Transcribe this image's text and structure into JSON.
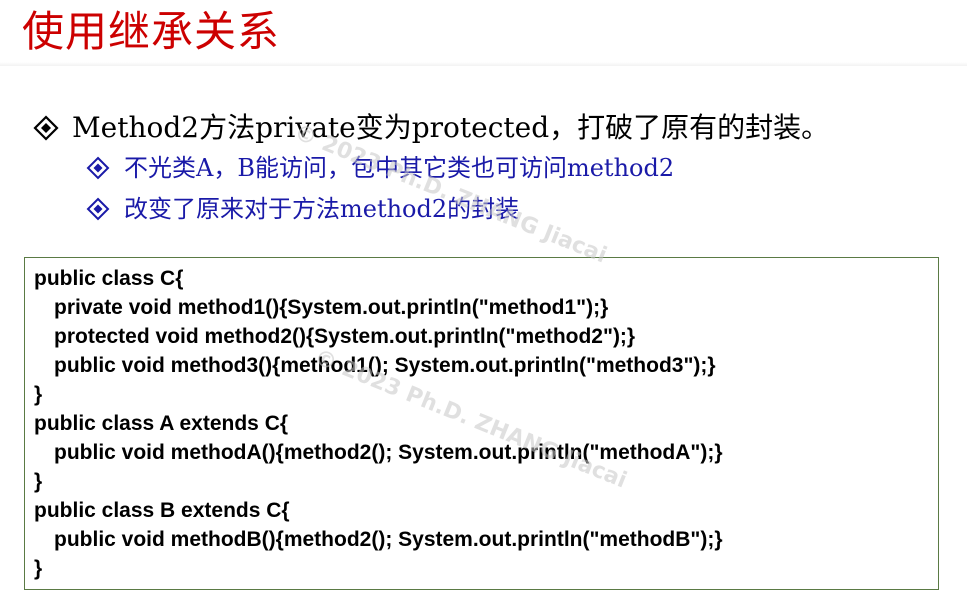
{
  "slide": {
    "title": "使用继承关系",
    "bullets": [
      {
        "level": 1,
        "text": "Method2方法private变为protected，打破了原有的封装。",
        "color": "#000000"
      },
      {
        "level": 2,
        "text": "不光类A，B能访问，包中其它类也可访问method2",
        "color": "#1a1aa8"
      },
      {
        "level": 2,
        "text": "改变了原来对于方法method2的封装",
        "color": "#1a1aa8"
      }
    ],
    "code_lines": [
      "public class C{",
      "  private void method1(){System.out.println(\"method1\");}",
      "  protected void method2(){System.out.println(\"method2\");}",
      "  public void method3(){method1(); System.out.println(\"method3\");}",
      "}",
      "public class A extends C{",
      "  public void methodA(){method2(); System.out.println(\"methodA\");}",
      "}",
      "public class B extends C{",
      "  public void methodB(){method2(); System.out.println(\"methodB\");}",
      "}"
    ],
    "watermark": "© 2023 Ph.D. ZHANG Jiacai",
    "colors": {
      "title": "#cc0000",
      "sub_bullet": "#1a1aa8",
      "code_border": "#5a7a44"
    },
    "bullet_icon": "diamond-bullet-icon"
  }
}
